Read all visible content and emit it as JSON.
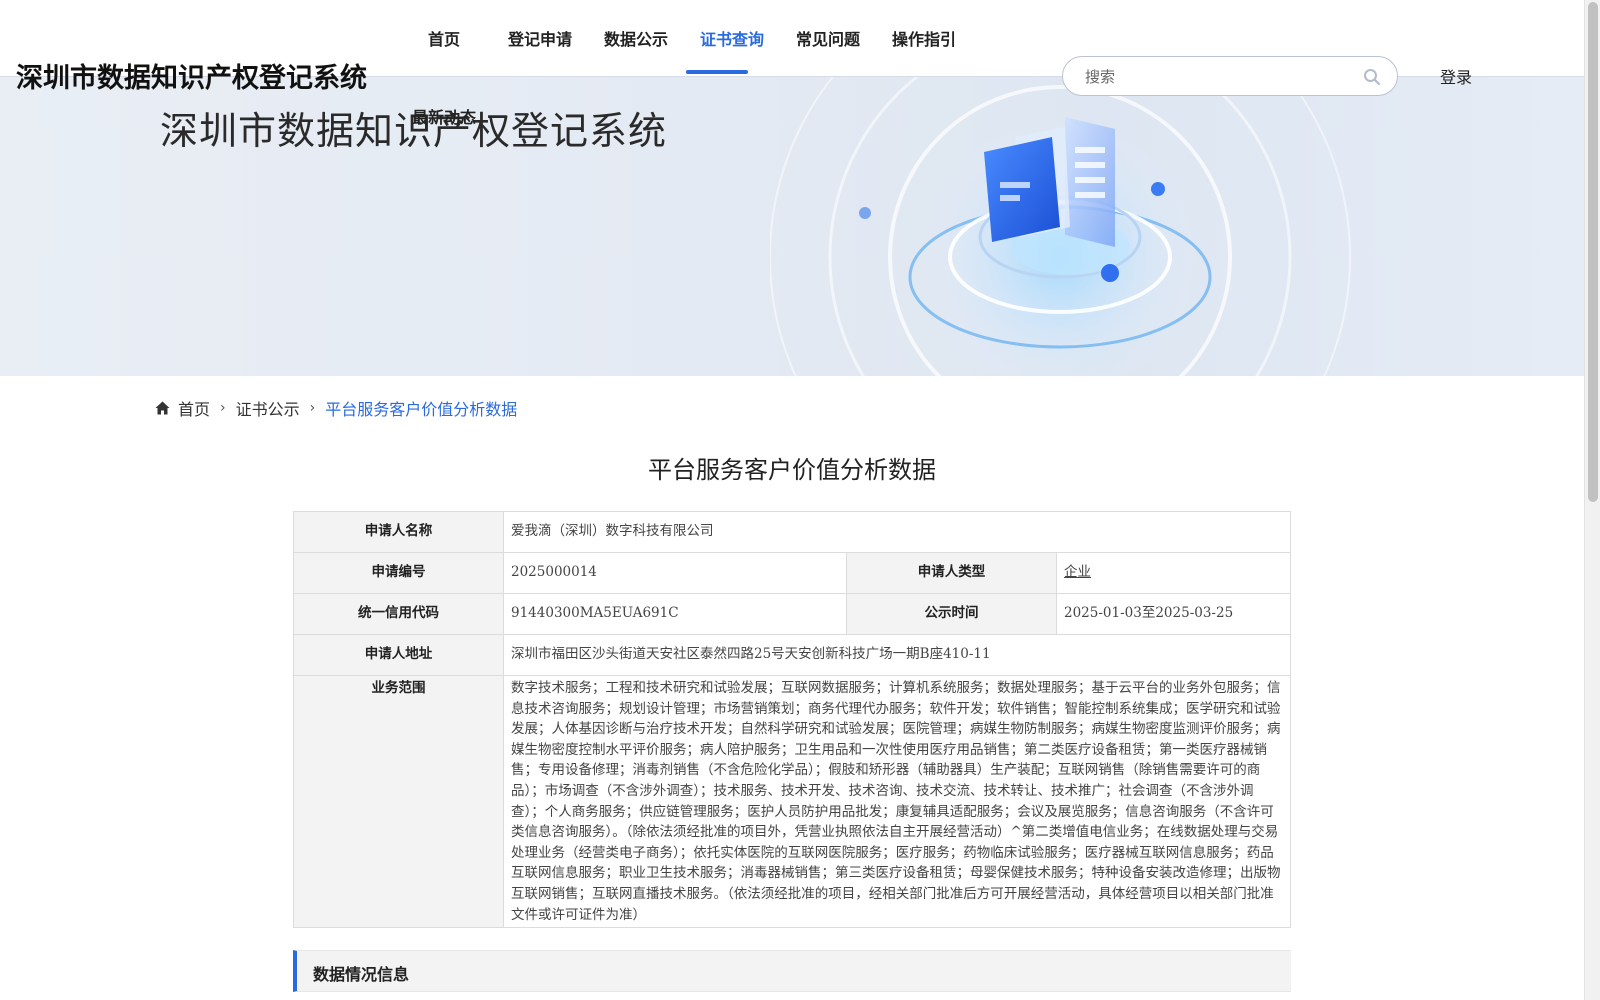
{
  "site": {
    "title": "深圳市数据知识产权登记系统"
  },
  "nav": {
    "items": [
      "首页",
      "登记申请",
      "数据公示",
      "证书查询",
      "常见问题",
      "操作指引"
    ],
    "active_index": 3,
    "second_row_item": "最新动态"
  },
  "search": {
    "placeholder": "搜索"
  },
  "login_label": "登录",
  "banner": {
    "title": "深圳市数据知识产权登记系统"
  },
  "breadcrumb": {
    "home": "首页",
    "level2": "证书公示",
    "current": "平台服务客户价值分析数据"
  },
  "page_title": "平台服务客户价值分析数据",
  "info": {
    "applicant_name_label": "申请人名称",
    "applicant_name": "爱我滴（深圳）数字科技有限公司",
    "app_no_label": "申请编号",
    "app_no": "2025000014",
    "applicant_type_label": "申请人类型",
    "applicant_type": "企业",
    "credit_code_label": "统一信用代码",
    "credit_code": "91440300MA5EUA691C",
    "publicity_time_label": "公示时间",
    "publicity_time": "2025-01-03至2025-03-25",
    "address_label": "申请人地址",
    "address": "深圳市福田区沙头街道天安社区泰然四路25号天安创新科技广场一期B座410-11",
    "scope_label": "业务范围",
    "scope": "数字技术服务；工程和技术研究和试验发展；互联网数据服务；计算机系统服务；数据处理服务；基于云平台的业务外包服务；信息技术咨询服务；规划设计管理；市场营销策划；商务代理代办服务；软件开发；软件销售；智能控制系统集成；医学研究和试验发展；人体基因诊断与治疗技术开发；自然科学研究和试验发展；医院管理；病媒生物防制服务；病媒生物密度监测评价服务；病媒生物密度控制水平评价服务；病人陪护服务；卫生用品和一次性使用医疗用品销售；第二类医疗设备租赁；第一类医疗器械销售；专用设备修理；消毒剂销售（不含危险化学品）；假肢和矫形器（辅助器具）生产装配；互联网销售（除销售需要许可的商品）；市场调查（不含涉外调查）；技术服务、技术开发、技术咨询、技术交流、技术转让、技术推广；社会调查（不含涉外调查）；个人商务服务；供应链管理服务；医护人员防护用品批发；康复辅具适配服务；会议及展览服务；信息咨询服务（不含许可类信息咨询服务）。（除依法须经批准的项目外，凭营业执照依法自主开展经营活动）^第二类增值电信业务；在线数据处理与交易处理业务（经营类电子商务）；依托实体医院的互联网医院服务；医疗服务；药物临床试验服务；医疗器械互联网信息服务；药品互联网信息服务；职业卫生技术服务；消毒器械销售；第三类医疗设备租赁；母婴保健技术服务；特种设备安装改造修理；出版物互联网销售；互联网直播技术服务。（依法须经批准的项目，经相关部门批准后方可开展经营活动，具体经营项目以相关部门批准文件或许可证件为准）"
  },
  "section_header": "数据情况信息",
  "colors": {
    "accent": "#2a6ae0"
  }
}
